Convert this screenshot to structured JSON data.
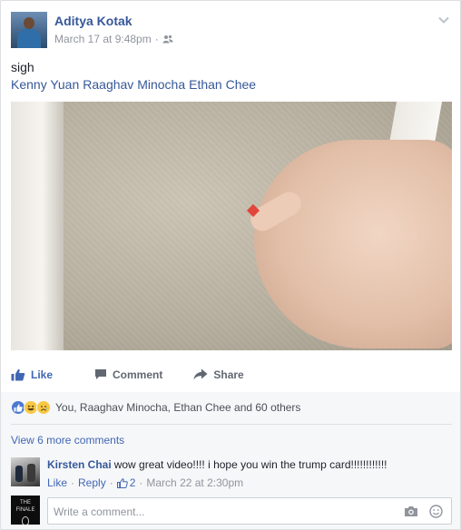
{
  "post": {
    "author": "Aditya Kotak",
    "timestamp": "March 17 at 9:48pm",
    "separator": "·",
    "privacy_icon": "friends-icon",
    "text": "sigh",
    "tags": [
      "Kenny Yuan",
      "Raaghav Minocha",
      "Ethan Chee"
    ]
  },
  "actions": {
    "like_label": "Like",
    "comment_label": "Comment",
    "share_label": "Share"
  },
  "reactions": {
    "icons": [
      "like-reaction-icon",
      "haha-reaction-icon",
      "sad-reaction-icon"
    ],
    "summary": "You, Raaghav Minocha, Ethan Chee and 60 others"
  },
  "comments": {
    "view_more": "View 6 more comments",
    "items": [
      {
        "author": "Kirsten Chai",
        "text": "wow great video!!!! i hope you win the trump card!!!!!!!!!!!!",
        "like_label": "Like",
        "reply_label": "Reply",
        "like_count": "2",
        "dot": "·",
        "timestamp": "March 22 at 2:30pm"
      }
    ]
  },
  "reply_box": {
    "avatar_text": "THE FINALE",
    "placeholder": "Write a comment..."
  },
  "colors": {
    "link": "#365899",
    "action_blue": "#4267b2",
    "muted": "#90949c"
  }
}
